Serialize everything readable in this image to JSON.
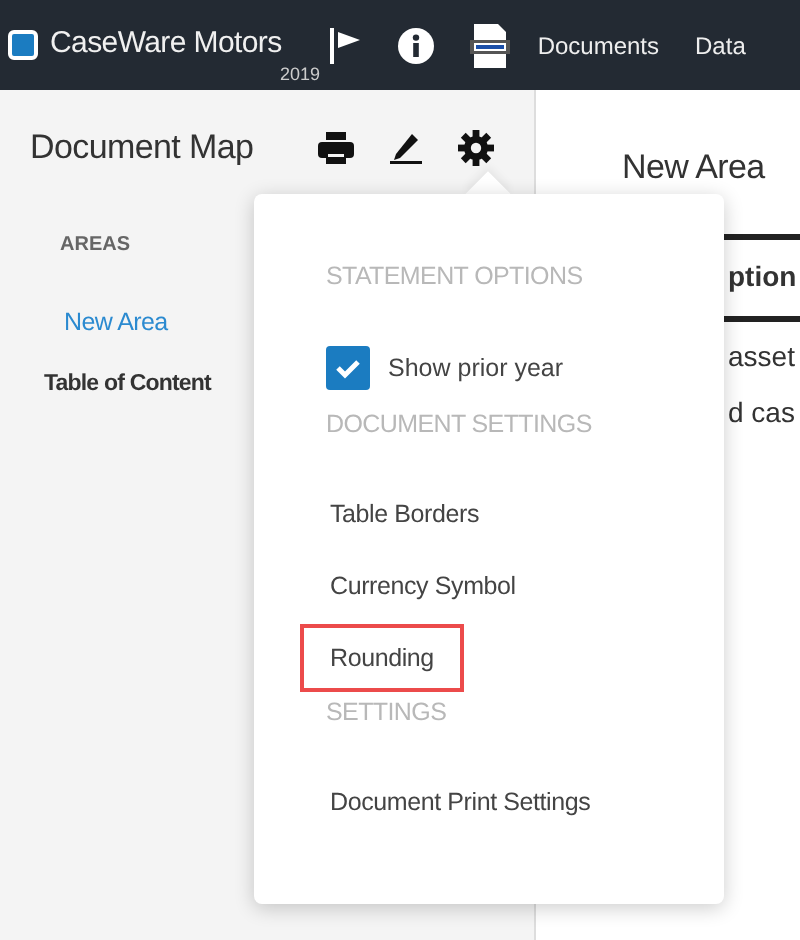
{
  "navbar": {
    "logo": "CaseWare Motors",
    "year": "2019",
    "links": [
      {
        "label": "Documents"
      },
      {
        "label": "Data"
      }
    ]
  },
  "sidebar": {
    "title": "Document Map",
    "section": "AREAS",
    "items": [
      {
        "label": "New Area",
        "selected": true
      },
      {
        "label": "Table of Content",
        "selected": false
      }
    ]
  },
  "content": {
    "title": "New Area",
    "column_1": "ption",
    "lines": [
      "asset",
      "d cas"
    ]
  },
  "menu": {
    "items": [
      {
        "kind": "header",
        "label": "STATEMENT OPTIONS"
      },
      {
        "kind": "checkbox",
        "label": "Show prior year",
        "checked": true
      },
      {
        "kind": "header",
        "label": "DOCUMENT SETTINGS"
      },
      {
        "kind": "item",
        "label": "Table Borders",
        "highlighted": false
      },
      {
        "kind": "item",
        "label": "Currency Symbol",
        "highlighted": false
      },
      {
        "kind": "item",
        "label": "Rounding",
        "highlighted": true
      },
      {
        "kind": "header",
        "label": "SETTINGS"
      },
      {
        "kind": "item",
        "label": "Document Print Settings",
        "highlighted": false
      }
    ]
  }
}
